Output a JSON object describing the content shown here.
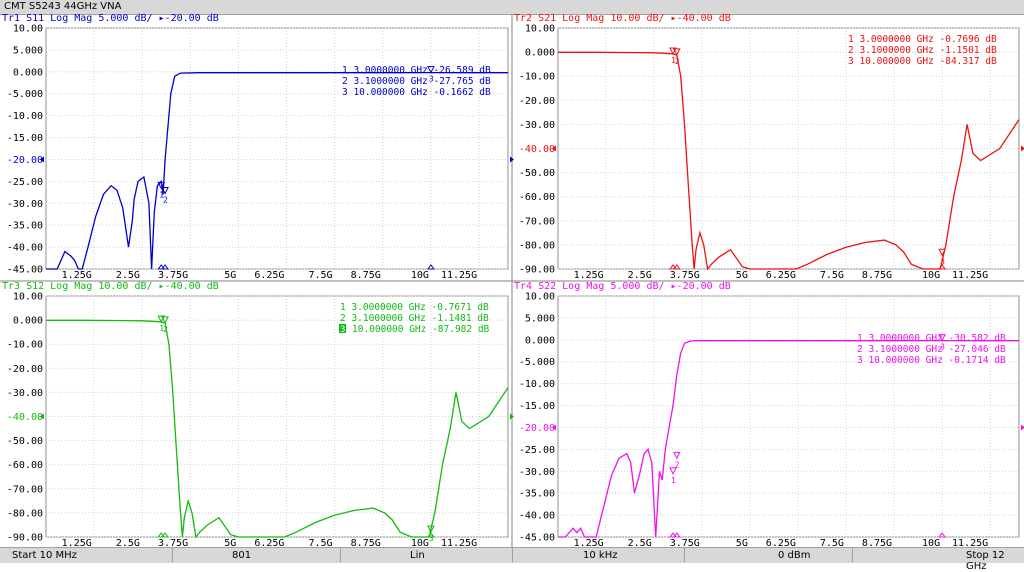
{
  "window": {
    "title": "CMT S5243 44GHz VNA"
  },
  "status": {
    "start": "Start 10 MHz",
    "points": "801",
    "sweep": "Lin",
    "ifbw": "10 kHz",
    "power": "0 dBm",
    "stop": "Stop 12 GHz"
  },
  "chart_data": [
    {
      "type": "line",
      "trace": "Tr1",
      "title": "Tr1 S11 Log Mag 5.000 dB/ ▸-20.00 dB",
      "color": "#0000cc",
      "ylim": [
        -45,
        10
      ],
      "yticks": [
        10,
        5,
        0,
        -5,
        -10,
        -15,
        -20,
        -25,
        -30,
        -35,
        -40,
        -45
      ],
      "ytick_labels": [
        "10.00",
        "5.000",
        "0.000",
        "-5.000",
        "-10.00",
        "-15.00",
        "-20.00",
        "-25.00",
        "-30.00",
        "-35.00",
        "-40.00",
        "-45.00"
      ],
      "ref_value": -20,
      "xlim": [
        0.01,
        12
      ],
      "xticks": [
        1.25,
        2.5,
        3.75,
        5,
        6.25,
        7.5,
        8.75,
        10,
        11.25
      ],
      "xtick_labels": [
        "1.25G",
        "2.5G",
        "3.75G",
        "5G",
        "6.25G",
        "7.5G",
        "8.75G",
        "10G",
        "11.25G"
      ],
      "grid": true,
      "markers": [
        {
          "id": "1",
          "text": "1  3.0000000 GHz  -26.589  dB",
          "x": 3.0,
          "y": -26.589
        },
        {
          "id": "2",
          "text": "2  3.1000000 GHz  -27.765  dB",
          "x": 3.1,
          "y": -27.765
        },
        {
          "id": "3",
          "text": "3  10.000000 GHz  -0.1662  dB",
          "x": 10.0,
          "y": -0.1662
        }
      ],
      "series": [
        {
          "x": [
            0.01,
            0.3,
            0.5,
            0.65,
            0.75,
            0.85,
            0.95,
            1.1,
            1.3,
            1.5,
            1.7,
            1.85,
            2.0,
            2.15,
            2.25,
            2.3,
            2.4,
            2.55,
            2.68,
            2.75,
            2.82,
            2.9,
            3.0,
            3.05,
            3.1,
            3.15,
            3.25,
            3.35,
            3.5,
            4.0,
            6.0,
            9.0,
            10.0,
            11.0,
            12.0
          ],
          "y": [
            -45,
            -45,
            -41,
            -42,
            -43,
            -45,
            -45,
            -40,
            -33,
            -28,
            -26,
            -27,
            -31,
            -40,
            -34,
            -29,
            -25,
            -24,
            -30,
            -45,
            -32,
            -26,
            -25,
            -28,
            -20,
            -15,
            -5,
            -1,
            -0.3,
            -0.2,
            -0.2,
            -0.2,
            -0.17,
            -0.2,
            -0.2
          ]
        }
      ]
    },
    {
      "type": "line",
      "trace": "Tr2",
      "title": "Tr2 S21 Log Mag 10.00 dB/ ▸-40.00 dB",
      "color": "#ee1111",
      "ylim": [
        -90,
        10
      ],
      "yticks": [
        10,
        0,
        -10,
        -20,
        -30,
        -40,
        -50,
        -60,
        -70,
        -80,
        -90
      ],
      "ytick_labels": [
        "10.00",
        "0.000",
        "-10.00",
        "-20.00",
        "-30.00",
        "-40.00",
        "-50.00",
        "-60.00",
        "-70.00",
        "-80.00",
        "-90.00"
      ],
      "ref_value": -40,
      "xlim": [
        0.01,
        12
      ],
      "xticks": [
        1.25,
        2.5,
        3.75,
        5,
        6.25,
        7.5,
        8.75,
        10,
        11.25
      ],
      "xtick_labels": [
        "1.25G",
        "2.5G",
        "3.75G",
        "5G",
        "6.25G",
        "7.5G",
        "8.75G",
        "10G",
        "11.25G"
      ],
      "grid": true,
      "markers": [
        {
          "id": "1",
          "text": "1  3.0000000 GHz  -0.7696  dB",
          "x": 3.0,
          "y": -0.7696
        },
        {
          "id": "2",
          "text": "2  3.1000000 GHz  -1.1501  dB",
          "x": 3.1,
          "y": -1.1501
        },
        {
          "id": "3",
          "text": "3  10.000000 GHz  -84.317  dB",
          "x": 10.0,
          "y": -84.317
        }
      ],
      "series": [
        {
          "x": [
            0.01,
            1.0,
            2.0,
            2.5,
            2.8,
            3.0,
            3.1,
            3.2,
            3.3,
            3.4,
            3.5,
            3.55,
            3.6,
            3.7,
            3.8,
            3.9,
            4.0,
            4.2,
            4.5,
            4.8,
            5.0,
            5.5,
            6.2,
            6.5,
            7.0,
            7.5,
            8.0,
            8.5,
            8.8,
            9.0,
            9.2,
            9.5,
            9.8,
            9.95,
            10.1,
            10.3,
            10.5,
            10.65,
            10.8,
            11.0,
            11.5,
            12.0
          ],
          "y": [
            -0.1,
            -0.1,
            -0.2,
            -0.3,
            -0.5,
            -0.8,
            -1.2,
            -10,
            -30,
            -55,
            -80,
            -90,
            -82,
            -75,
            -80,
            -90,
            -88,
            -85,
            -82,
            -89,
            -90,
            -90,
            -90,
            -88,
            -84,
            -81,
            -79,
            -78,
            -80,
            -83,
            -88,
            -90,
            -90,
            -90,
            -80,
            -60,
            -45,
            -30,
            -42,
            -45,
            -40,
            -28
          ]
        }
      ]
    },
    {
      "type": "line",
      "trace": "Tr3",
      "title": "Tr3 S12 Log Mag 10.00 dB/ ▸-40.00 dB",
      "color": "#11bb11",
      "ylim": [
        -90,
        10
      ],
      "yticks": [
        10,
        0,
        -10,
        -20,
        -30,
        -40,
        -50,
        -60,
        -70,
        -80,
        -90
      ],
      "ytick_labels": [
        "10.00",
        "0.000",
        "-10.00",
        "-20.00",
        "-30.00",
        "-40.00",
        "-50.00",
        "-60.00",
        "-70.00",
        "-80.00",
        "-90.00"
      ],
      "ref_value": -40,
      "xlim": [
        0.01,
        12
      ],
      "xticks": [
        1.25,
        2.5,
        3.75,
        5,
        6.25,
        7.5,
        8.75,
        10,
        11.25
      ],
      "xtick_labels": [
        "1.25G",
        "2.5G",
        "3.75G",
        "5G",
        "6.25G",
        "7.5G",
        "8.75G",
        "10G",
        "11.25G"
      ],
      "grid": true,
      "markers": [
        {
          "id": "1",
          "text": "1  3.0000000 GHz  -0.7671  dB",
          "x": 3.0,
          "y": -0.7671
        },
        {
          "id": "2",
          "text": "2  3.1000000 GHz  -1.1481  dB",
          "x": 3.1,
          "y": -1.1481
        },
        {
          "id": "3",
          "text": "10.000000 GHz  -87.982  dB",
          "x": 10.0,
          "y": -87.982
        }
      ],
      "series": [
        {
          "x": [
            0.01,
            1.0,
            2.0,
            2.5,
            2.8,
            3.0,
            3.1,
            3.2,
            3.3,
            3.4,
            3.5,
            3.55,
            3.6,
            3.7,
            3.8,
            3.9,
            4.0,
            4.2,
            4.5,
            4.8,
            5.0,
            5.5,
            6.2,
            6.5,
            7.0,
            7.5,
            8.0,
            8.5,
            8.8,
            9.0,
            9.2,
            9.5,
            9.8,
            9.95,
            10.1,
            10.3,
            10.5,
            10.65,
            10.8,
            11.0,
            11.5,
            12.0
          ],
          "y": [
            -0.1,
            -0.1,
            -0.2,
            -0.3,
            -0.5,
            -0.8,
            -1.2,
            -10,
            -30,
            -55,
            -80,
            -90,
            -82,
            -75,
            -80,
            -90,
            -88,
            -85,
            -82,
            -89,
            -90,
            -90,
            -90,
            -88,
            -84,
            -81,
            -79,
            -78,
            -80,
            -83,
            -88,
            -90,
            -90,
            -90,
            -80,
            -60,
            -45,
            -30,
            -42,
            -45,
            -40,
            -28
          ]
        }
      ]
    },
    {
      "type": "line",
      "trace": "Tr4",
      "title": "Tr4 S22 Log Mag 5.000 dB/ ▸-20.00 dB",
      "color": "#ee11ee",
      "ylim": [
        -45,
        10
      ],
      "yticks": [
        10,
        5,
        0,
        -5,
        -10,
        -15,
        -20,
        -25,
        -30,
        -35,
        -40,
        -45
      ],
      "ytick_labels": [
        "10.00",
        "5.000",
        "0.000",
        "-5.000",
        "-10.00",
        "-15.00",
        "-20.00",
        "-25.00",
        "-30.00",
        "-35.00",
        "-40.00",
        "-45.00"
      ],
      "ref_value": -20,
      "xlim": [
        0.01,
        12
      ],
      "xticks": [
        1.25,
        2.5,
        3.75,
        5,
        6.25,
        7.5,
        8.75,
        10,
        11.25
      ],
      "xtick_labels": [
        "1.25G",
        "2.5G",
        "3.75G",
        "5G",
        "6.25G",
        "7.5G",
        "8.75G",
        "10G",
        "11.25G"
      ],
      "grid": true,
      "markers": [
        {
          "id": "1",
          "text": "1  3.0000000 GHz  -30.582  dB",
          "x": 3.0,
          "y": -30.582
        },
        {
          "id": "2",
          "text": "2  3.1000000 GHz  -27.046  dB",
          "x": 3.1,
          "y": -27.046
        },
        {
          "id": "3",
          "text": "3  10.000000 GHz  -0.1714  dB",
          "x": 10.0,
          "y": -0.1714
        }
      ],
      "series": [
        {
          "x": [
            0.01,
            0.2,
            0.4,
            0.5,
            0.6,
            0.7,
            0.8,
            1.0,
            1.2,
            1.4,
            1.6,
            1.8,
            1.9,
            2.0,
            2.15,
            2.25,
            2.35,
            2.45,
            2.55,
            2.65,
            2.72,
            2.8,
            2.9,
            3.0,
            3.1,
            3.2,
            3.3,
            3.45,
            3.6,
            4.0,
            6.0,
            9.0,
            10.0,
            11.0,
            12.0
          ],
          "y": [
            -45,
            -45,
            -43,
            -44,
            -43,
            -45,
            -45,
            -45,
            -38,
            -31,
            -27,
            -26,
            -28,
            -35,
            -30,
            -26,
            -25,
            -28,
            -45,
            -30,
            -32,
            -25,
            -20,
            -15,
            -8,
            -3,
            -0.8,
            -0.3,
            -0.2,
            -0.2,
            -0.2,
            -0.2,
            -0.17,
            -0.2,
            -0.2
          ]
        }
      ]
    }
  ]
}
